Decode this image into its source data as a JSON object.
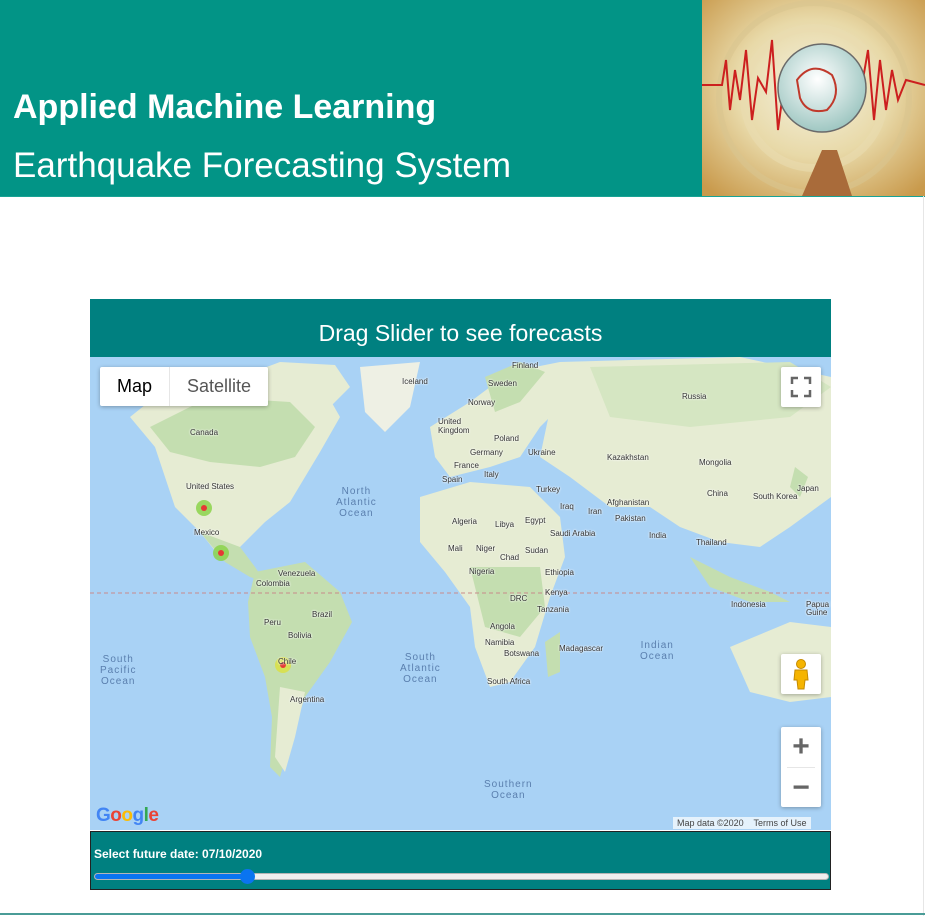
{
  "header": {
    "title": "Applied Machine Learning",
    "subtitle": "Earthquake Forecasting System",
    "image_icon": "seismograph-globe-icon"
  },
  "panel": {
    "heading": "Drag Slider to see forecasts"
  },
  "map": {
    "type_map_label": "Map",
    "type_satellite_label": "Satellite",
    "fullscreen_icon": "fullscreen-icon",
    "pegman_icon": "street-view-icon",
    "zoom_in_label": "+",
    "zoom_out_label": "−",
    "logo_text": "Google",
    "attribution": "Map data ©2020",
    "terms": "Terms of Use",
    "countries": {
      "finland": "Finland",
      "iceland": "Iceland",
      "sweden": "Sweden",
      "norway": "Norway",
      "russia": "Russia",
      "canada": "Canada",
      "uk": "United\nKingdom",
      "poland": "Poland",
      "germany": "Germany",
      "ukraine": "Ukraine",
      "kazakhstan": "Kazakhstan",
      "mongolia": "Mongolia",
      "france": "France",
      "spain": "Spain",
      "italy": "Italy",
      "turkey": "Turkey",
      "us": "United States",
      "china": "China",
      "skorea": "South Korea",
      "japan": "Japan",
      "iraq": "Iraq",
      "iran": "Iran",
      "afghanistan": "Afghanistan",
      "pakistan": "Pakistan",
      "algeria": "Algeria",
      "libya": "Libya",
      "egypt": "Egypt",
      "saudi": "Saudi Arabia",
      "india": "India",
      "mexico": "Mexico",
      "mali": "Mali",
      "niger": "Niger",
      "chad": "Chad",
      "sudan": "Sudan",
      "thailand": "Thailand",
      "venezuela": "Venezuela",
      "colombia": "Colombia",
      "nigeria": "Nigeria",
      "ethiopia": "Ethiopia",
      "kenya": "Kenya",
      "drc": "DRC",
      "indonesia": "Indonesia",
      "png": "Papua N\nGuine",
      "tanzania": "Tanzania",
      "brazil": "Brazil",
      "peru": "Peru",
      "angola": "Angola",
      "bolivia": "Bolivia",
      "namibia": "Namibia",
      "madagascar": "Madagascar",
      "botswana": "Botswana",
      "chile": "Chile",
      "safrica": "South Africa",
      "argentina": "Argentina"
    },
    "oceans": {
      "north_atlantic": "North\nAtlantic\nOcean",
      "south_pacific": "South\nPacific\nOcean",
      "south_atlantic": "South\nAtlantic\nOcean",
      "indian": "Indian\nOcean",
      "southern": "Southern\nOcean"
    },
    "colors": {
      "water": "#a9d2f5",
      "land": "#e6ecd3",
      "forest": "#c4deb0",
      "hotspot": "#e53935",
      "hotspot_halo": "#8bd34a"
    }
  },
  "slider": {
    "label": "Select future date: 07/10/2020",
    "value_fraction": 0.207
  }
}
